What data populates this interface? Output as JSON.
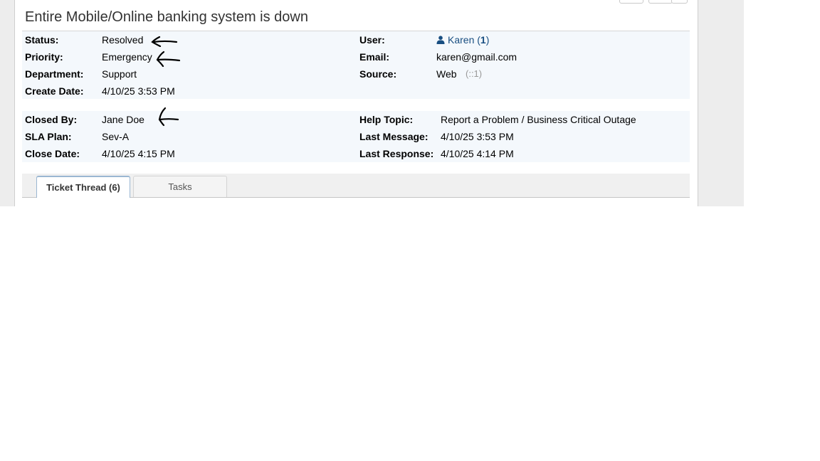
{
  "ticket": {
    "title": "Entire Mobile/Online banking system is down"
  },
  "left_info": {
    "status_label": "Status:",
    "status_value": "Resolved",
    "priority_label": "Priority:",
    "priority_value": "Emergency",
    "department_label": "Department:",
    "department_value": "Support",
    "create_date_label": "Create Date:",
    "create_date_value": "4/10/25 3:53 PM"
  },
  "right_info": {
    "user_label": "User:",
    "user_name": "Karen",
    "user_count": "1",
    "email_label": "Email:",
    "email_value": "karen@gmail.com",
    "source_label": "Source:",
    "source_value": "Web",
    "source_ip": "(::1)"
  },
  "left_info2": {
    "closed_by_label": "Closed By:",
    "closed_by_value": "Jane Doe",
    "sla_label": "SLA Plan:",
    "sla_value": "Sev-A",
    "close_date_label": "Close Date:",
    "close_date_value": "4/10/25 4:15 PM"
  },
  "right_info2": {
    "help_topic_label": "Help Topic:",
    "help_topic_value": "Report a Problem / Business Critical Outage",
    "last_message_label": "Last Message:",
    "last_message_value": "4/10/25 3:53 PM",
    "last_response_label": "Last Response:",
    "last_response_value": "4/10/25 4:14 PM"
  },
  "tabs": [
    {
      "label": "Ticket Thread (6)",
      "active": true
    },
    {
      "label": "Tasks",
      "active": false
    }
  ],
  "colors": {
    "link": "#184e81",
    "info_bg": "#f4f8fc"
  },
  "icons": {
    "user": "user-icon",
    "annotation": "hand-drawn-arrow-icon"
  }
}
